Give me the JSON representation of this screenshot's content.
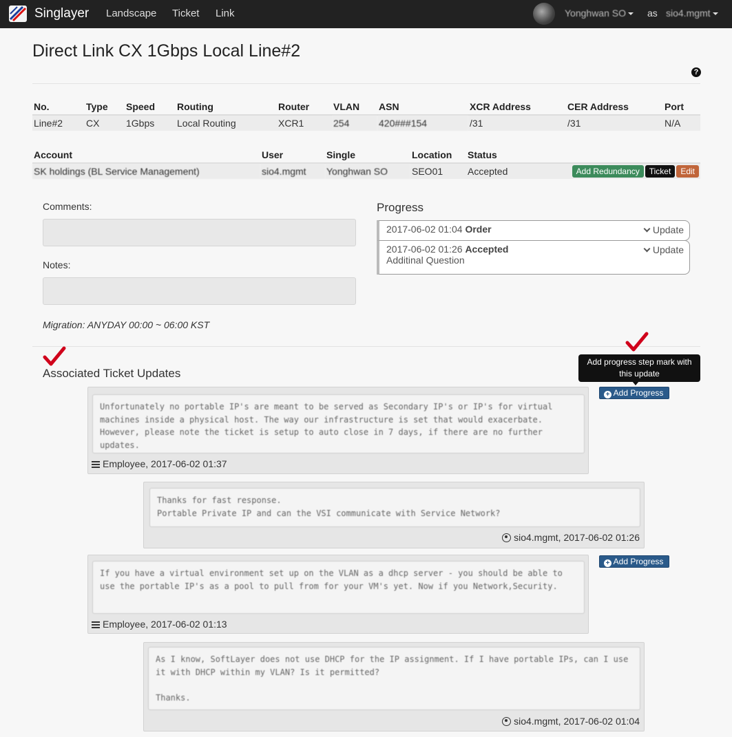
{
  "nav": {
    "brand": "Singlayer",
    "links": [
      "Landscape",
      "Ticket",
      "Link"
    ],
    "user": "Yonghwan SO",
    "as_label": "as",
    "account": "sio4.mgmt"
  },
  "page": {
    "title_prefix": "Direct Link ",
    "title_name": "CX 1Gbps Local Line#2",
    "help": "?"
  },
  "link_table": {
    "headers": [
      "No.",
      "Type",
      "Speed",
      "Routing",
      "Router",
      "VLAN",
      "ASN",
      "XCR Address",
      "CER Address",
      "Port"
    ],
    "row": [
      "Line#2",
      "CX",
      "1Gbps",
      "Local Routing",
      "XCR1",
      "254",
      "420###154",
      "/31",
      "/31",
      "N/A"
    ]
  },
  "account_table": {
    "headers": [
      "Account",
      "User",
      "Single",
      "Location",
      "Status"
    ],
    "row": [
      "SK holdings (BL Service Management)",
      "sio4.mgmt",
      "Yonghwan SO",
      "SEO01",
      "Accepted"
    ],
    "buttons": {
      "redundancy": "Add Redundancy",
      "ticket": "Ticket",
      "edit": "Edit"
    }
  },
  "form": {
    "comments_label": "Comments:",
    "notes_label": "Notes:",
    "migration": "Migration: ANYDAY 00:00 ~ 06:00 KST"
  },
  "progress": {
    "title": "Progress",
    "items": [
      {
        "time": "2017-06-02 01:04",
        "status": "Order",
        "note": "",
        "action": "Update"
      },
      {
        "time": "2017-06-02 01:26",
        "status": "Accepted",
        "note": "Additinal Question",
        "action": "Update"
      }
    ]
  },
  "tickets": {
    "title": "Associated Ticket Updates",
    "tooltip": "Add progress step mark with this update",
    "add_progress_label": "Add Progress",
    "updates": [
      {
        "text": "Unfortunately no portable IP's are meant to be served as Secondary IP's or IP's for virtual machines inside a physical host. The way our infrastructure is set that would exacerbate. However, please note the ticket is setup to auto close in 7 days, if there are no further updates.",
        "meta": "Employee, 2017-06-02 01:37"
      },
      {
        "text": "Thanks for fast response.\nPortable Private IP and can the VSI communicate with Service Network?",
        "meta": "sio4.mgmt, 2017-06-02 01:26"
      },
      {
        "text": "If you have a virtual environment set up on the VLAN as a dhcp server - you should be able to use the portable IP's as a pool to pull from for your VM's yet. Now if you Network,Security.",
        "meta": "Employee, 2017-06-02 01:13"
      },
      {
        "text": "As I know, SoftLayer does not use DHCP for the IP assignment. If I have portable IPs, can I use it with DHCP within my VLAN? Is it permitted?\n\nThanks.",
        "meta": "sio4.mgmt, 2017-06-02 01:04"
      }
    ]
  },
  "colors": {
    "navbar": "#222222",
    "add_progress": "#2a5a8a",
    "checkmark": "#d0021b"
  }
}
